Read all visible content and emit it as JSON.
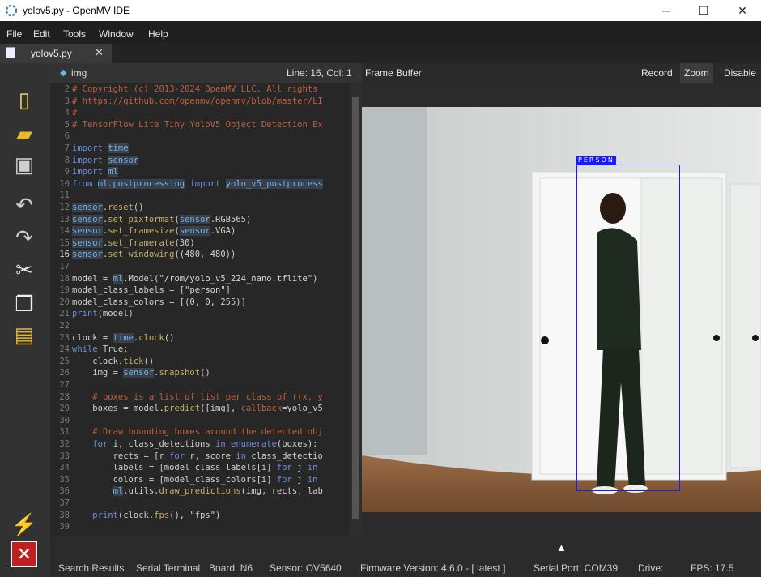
{
  "window": {
    "title": "yolov5.py - OpenMV IDE",
    "minimize": "─",
    "maximize": "☐",
    "close": "✕"
  },
  "menu": [
    "File",
    "Edit",
    "Tools",
    "Window",
    "Help"
  ],
  "tab": {
    "label": "yolov5.py",
    "close": "✕"
  },
  "toolbar": [
    {
      "name": "new-file-icon",
      "glyph": "📄"
    },
    {
      "name": "open-folder-icon",
      "glyph": "📂"
    },
    {
      "name": "save-icon",
      "glyph": "💾"
    },
    {
      "name": "undo-icon",
      "glyph": "↶"
    },
    {
      "name": "redo-icon",
      "glyph": "↷"
    },
    {
      "name": "cut-icon",
      "glyph": "✂"
    },
    {
      "name": "copy-icon",
      "glyph": "📋"
    },
    {
      "name": "paste-icon",
      "glyph": "📋"
    }
  ],
  "editor": {
    "buffer_name": "img",
    "line_col": "Line: 16, Col: 1",
    "lines": [
      {
        "n": "2",
        "html": "<span class='cm'># Copyright (c) 2013-2024 OpenMV LLC. All rights</span>"
      },
      {
        "n": "3",
        "html": "<span class='cm'># https://github.com/openmv/openmv/blob/master/LI</span>"
      },
      {
        "n": "4",
        "html": "<span class='cm'>#</span>"
      },
      {
        "n": "5",
        "html": "<span class='cm'># TensorFlow Lite Tiny YoloV5 Object Detection Ex</span>"
      },
      {
        "n": "6",
        "html": ""
      },
      {
        "n": "7",
        "html": "<span class='kw'>import</span> <span class='md'>time</span>"
      },
      {
        "n": "8",
        "html": "<span class='kw'>import</span> <span class='md'>sensor</span>"
      },
      {
        "n": "9",
        "html": "<span class='kw'>import</span> <span class='md'>ml</span>"
      },
      {
        "n": "10",
        "html": "<span class='kw'>from</span> <span class='md'>ml.postprocessing</span> <span class='kw'>import</span> <span class='md'>yolo_v5_postprocess</span>"
      },
      {
        "n": "11",
        "html": ""
      },
      {
        "n": "12",
        "html": "<span class='md'>sensor</span>.<span class='fn'>reset</span>()"
      },
      {
        "n": "13",
        "html": "<span class='md'>sensor</span>.<span class='fn'>set_pixformat</span>(<span class='md'>sensor</span>.RGB565)"
      },
      {
        "n": "14",
        "html": "<span class='md'>sensor</span>.<span class='fn'>set_framesize</span>(<span class='md'>sensor</span>.VGA)"
      },
      {
        "n": "15",
        "html": "<span class='md'>sensor</span>.<span class='fn'>set_framerate</span>(30)"
      },
      {
        "n": "16",
        "html": "<span class='md'>sensor</span>.<span class='fn'>set_windowing</span>((480, 480))"
      },
      {
        "n": "17",
        "html": ""
      },
      {
        "n": "18",
        "html": "model = <span class='md'>ml</span>.Model(<span class='st'>\"/rom/yolo_v5_224_nano.tflite\"</span>)"
      },
      {
        "n": "19",
        "html": "model_class_labels = [<span class='st'>\"person\"</span>]"
      },
      {
        "n": "20",
        "html": "model_class_colors = [(0, 0, 255)]"
      },
      {
        "n": "21",
        "html": "<span class='kw'>print</span>(model)"
      },
      {
        "n": "22",
        "html": ""
      },
      {
        "n": "23",
        "html": "clock = <span class='md'>time</span>.<span class='fn'>clock</span>()"
      },
      {
        "n": "24",
        "html": "<span class='kw'>while</span> True:"
      },
      {
        "n": "25",
        "html": "    clock.<span class='fn'>tick</span>()"
      },
      {
        "n": "26",
        "html": "    img = <span class='md'>sensor</span>.<span class='fn'>snapshot</span>()"
      },
      {
        "n": "27",
        "html": ""
      },
      {
        "n": "28",
        "html": "    <span class='cm'># boxes is a list of list per class of ((x, y</span>"
      },
      {
        "n": "29",
        "html": "    boxes = model.<span class='fn'>predict</span>([img], <span class='cm'>callback</span>=yolo_v5"
      },
      {
        "n": "30",
        "html": ""
      },
      {
        "n": "31",
        "html": "    <span class='cm'># Draw bounding boxes around the detected obj</span>"
      },
      {
        "n": "32",
        "html": "    <span class='kw'>for</span> i, class_detections <span class='kw'>in</span> <span class='kw'>enumerate</span>(boxes):"
      },
      {
        "n": "33",
        "html": "        rects = [r <span class='kw'>for</span> r, score <span class='kw'>in</span> class_detectio"
      },
      {
        "n": "34",
        "html": "        labels = [model_class_labels[i] <span class='kw'>for</span> j <span class='kw'>in</span>"
      },
      {
        "n": "35",
        "html": "        colors = [model_class_colors[i] <span class='kw'>for</span> j <span class='kw'>in</span>"
      },
      {
        "n": "36",
        "html": "        <span class='md'>ml</span>.utils.<span class='fn'>draw_predictions</span>(img, rects, lab"
      },
      {
        "n": "37",
        "html": ""
      },
      {
        "n": "38",
        "html": "    <span class='kw'>print</span>(clock.<span class='fn'>fps</span>(), <span class='st'>\"fps\"</span>)"
      },
      {
        "n": "39",
        "html": ""
      }
    ]
  },
  "framebuffer": {
    "title": "Frame Buffer",
    "buttons": [
      "Record",
      "Zoom",
      "Disable"
    ],
    "detection_label": "PERSON",
    "box_color": "#1a1aff"
  },
  "status": {
    "search": "Search Results",
    "serial": "Serial Terminal",
    "board": "Board: N6",
    "sensor": "Sensor: OV5640",
    "firmware": "Firmware Version: 4.6.0 - [ latest ]",
    "port": "Serial Port: COM39",
    "drive": "Drive:",
    "fps": "FPS: 17.5"
  }
}
